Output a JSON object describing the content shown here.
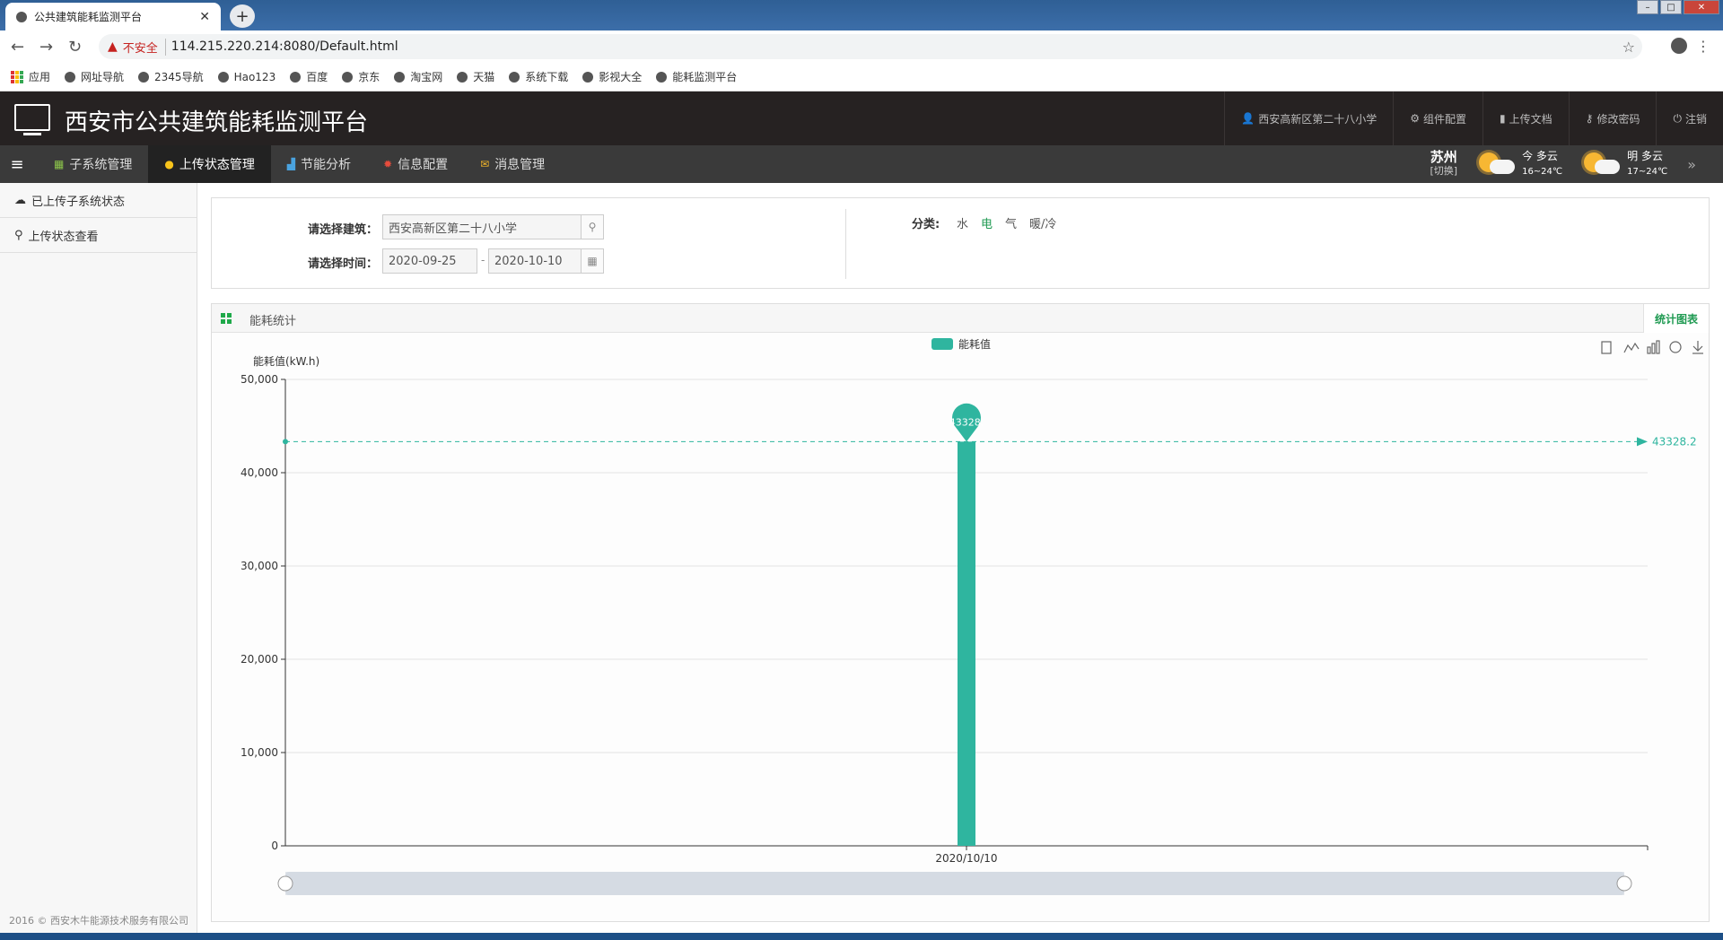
{
  "browser": {
    "tab_title": "公共建筑能耗监测平台",
    "insecure_label": "不安全",
    "url": "114.215.220.214:8080/Default.html",
    "bookmarks": [
      "网址导航",
      "2345导航",
      "Hao123",
      "百度",
      "京东",
      "淘宝网",
      "天猫",
      "系统下载",
      "影视大全",
      "能耗监测平台"
    ],
    "apps_label": "应用"
  },
  "header": {
    "title": "西安市公共建筑能耗监测平台",
    "links": {
      "user": "西安高新区第二十八小学",
      "config": "组件配置",
      "upload_doc": "上传文档",
      "change_pwd": "修改密码",
      "logout": "注销"
    }
  },
  "menu": {
    "items": [
      "子系统管理",
      "上传状态管理",
      "节能分析",
      "信息配置",
      "消息管理"
    ],
    "active_index": 1
  },
  "weather": {
    "city": "苏州",
    "switch": "[切换]",
    "today": {
      "label": "今 多云",
      "temp": "16~24℃"
    },
    "tomorrow": {
      "label": "明 多云",
      "temp": "17~24℃"
    }
  },
  "sidebar": {
    "items": [
      "已上传子系统状态",
      "上传状态查看"
    ],
    "copyright": "2016 © 西安木牛能源技术服务有限公司"
  },
  "filter": {
    "building_label": "请选择建筑：",
    "building_value": "西安高新区第二十八小学",
    "time_label": "请选择时间：",
    "date_from": "2020-09-25",
    "date_to": "2020-10-10",
    "date_sep": "-",
    "category_label": "分类:",
    "categories": [
      "水",
      "电",
      "气",
      "暖/冷"
    ],
    "active_category": 1
  },
  "chart_panel": {
    "title": "能耗统计",
    "tab": "统计图表"
  },
  "chart_data": {
    "type": "bar",
    "legend": "能耗值",
    "ylabel": "能耗值(kW.h)",
    "categories": [
      "2020/10/10"
    ],
    "values": [
      43328.2
    ],
    "ylim": [
      0,
      50000
    ],
    "yticks": [
      "0",
      "10,000",
      "20,000",
      "30,000",
      "40,000",
      "50,000"
    ],
    "max_pin_label": "43328.",
    "mark_line_label": "43328.2",
    "color": "#2fb59f"
  }
}
